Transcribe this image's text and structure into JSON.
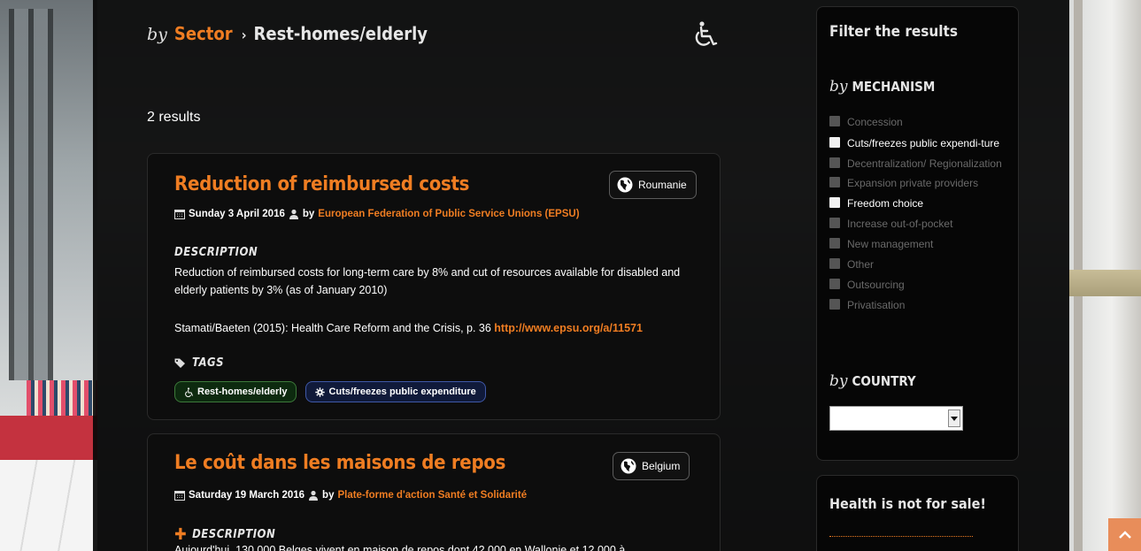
{
  "breadcrumb": {
    "by": "by",
    "sector": "Sector",
    "separator": "›",
    "current": "Rest-homes/elderly"
  },
  "icons": {
    "sector": "wheelchair-icon",
    "country": "globe-icon",
    "calendar": "calendar-icon",
    "user": "user-icon",
    "tag": "tag-icon",
    "gear": "gear-icon",
    "scroll_top": "chevron-up-icon"
  },
  "colors": {
    "accent": "#ef7d22",
    "panel": "#080808",
    "tag_green": "#3d7a3a",
    "tag_blue": "#3f58a8"
  },
  "results": {
    "count": "2 results",
    "items": [
      {
        "title": "Reduction of reimbursed costs",
        "country": "Roumanie",
        "date": "Sunday 3 April 2016",
        "by": "by",
        "author": "European Federation of Public Service Unions (EPSU)",
        "description_label": "DESCRIPTION",
        "description": "Reduction of reimbursed costs for long-term care by 8% and cut of resources available for disabled and elderly patients by 3% (as of January 2010)",
        "source": "Stamati/Baeten (2015): Health Care Reform and the Crisis, p. 36",
        "source_link": "http://www.epsu.org/a/11571",
        "tags_label": "TAGS",
        "tags": [
          "Rest-homes/elderly",
          "Cuts/freezes public expenditure"
        ]
      },
      {
        "title": "Le coût dans les maisons de repos",
        "country": "Belgium",
        "date": "Saturday 19 March 2016",
        "by": "by",
        "author": "Plate-forme d'action Santé et Solidarité",
        "description_label": "DESCRIPTION",
        "description_preview": "Aujourd'hui, 130.000 Belges vivent en maison de repos dont 42.000 en Wallonie et 12.000 à"
      }
    ]
  },
  "sidebar": {
    "title": "Filter the results",
    "by": "by",
    "mechanism_head": "MECHANISM",
    "mechanisms": [
      {
        "label": "Concession",
        "active": false
      },
      {
        "label": "Cuts/freezes public expendi-ture",
        "active": true
      },
      {
        "label": "Decentralization/ Regionalization",
        "active": false
      },
      {
        "label": "Expansion private providers",
        "active": false
      },
      {
        "label": "Freedom choice",
        "active": true
      },
      {
        "label": "Increase out-of-pocket",
        "active": false
      },
      {
        "label": "New management",
        "active": false
      },
      {
        "label": "Other",
        "active": false
      },
      {
        "label": "Outsourcing",
        "active": false
      },
      {
        "label": "Privatisation",
        "active": false
      }
    ],
    "country_head": "COUNTRY",
    "country_value": ""
  },
  "sidebar2": {
    "title": "Health is not for sale!"
  }
}
